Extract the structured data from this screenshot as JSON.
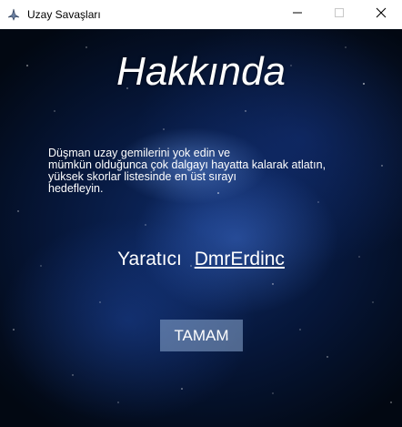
{
  "window": {
    "title": "Uzay Savaşları",
    "app_icon": "spaceship-icon",
    "controls": {
      "minimize": "minimize-icon",
      "maximize": "maximize-icon",
      "close": "close-icon"
    }
  },
  "about": {
    "heading": "Hakkında",
    "description_lines": [
      "Düşman uzay gemilerini yok edin ve",
      "mümkün olduğunca çok dalgayı hayatta kalarak atlatın,",
      "yüksek skorlar listesinde en üst sırayı",
      "hedefleyin."
    ],
    "creator_label": "Yaratıcı",
    "creator_name": "DmrErdinc",
    "ok_button": "TAMAM"
  },
  "colors": {
    "background_dark": "#020812",
    "background_mid": "#0e2a66",
    "nebula_highlight": "#78aaff",
    "text": "#ffffff",
    "button_fill": "#8caad2"
  }
}
